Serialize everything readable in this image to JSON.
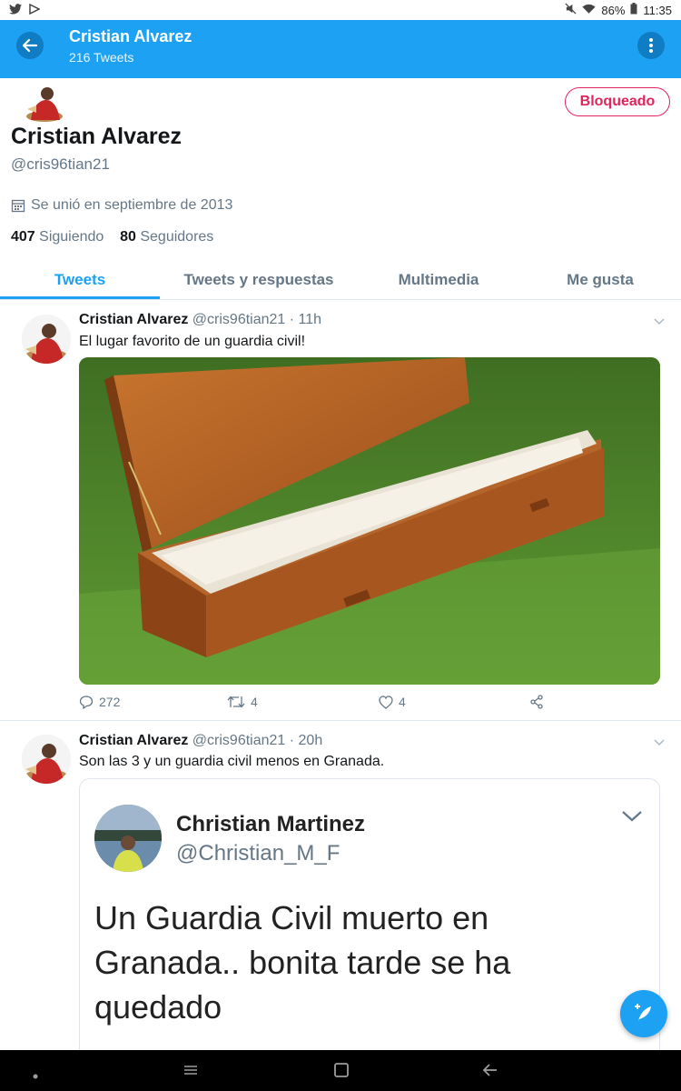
{
  "statusbar": {
    "battery": "86%",
    "time": "11:35"
  },
  "appbar": {
    "title": "Cristian Alvarez",
    "subtitle": "216 Tweets"
  },
  "profile": {
    "name": "Cristian Alvarez",
    "handle": "@cris96tian21",
    "blocked_label": "Bloqueado",
    "joined": "Se unió en septiembre de 2013",
    "following_count": "407",
    "following_label": "Siguiendo",
    "followers_count": "80",
    "followers_label": "Seguidores"
  },
  "tabs": [
    {
      "label": "Tweets",
      "active": true
    },
    {
      "label": "Tweets y respuestas"
    },
    {
      "label": "Multimedia"
    },
    {
      "label": "Me gusta"
    }
  ],
  "tweets": [
    {
      "name": "Cristian Alvarez",
      "meta": "@cris96tian21 · 11h",
      "text": "El lugar favorito de un guardia civil!",
      "replies": "272",
      "retweets": "4",
      "likes": "4"
    },
    {
      "name": "Cristian Alvarez",
      "meta": "@cris96tian21 · 20h",
      "text": "Son las 3 y un guardia civil menos en Granada."
    }
  ],
  "quoted": {
    "name": "Christian Martinez",
    "handle": "@Christian_M_F",
    "text": "Un Guardia Civil muerto en Granada.. bonita tarde se ha quedado"
  },
  "colors": {
    "accent": "#1da1f2",
    "blocked": "#e0245e",
    "muted": "#657786"
  }
}
